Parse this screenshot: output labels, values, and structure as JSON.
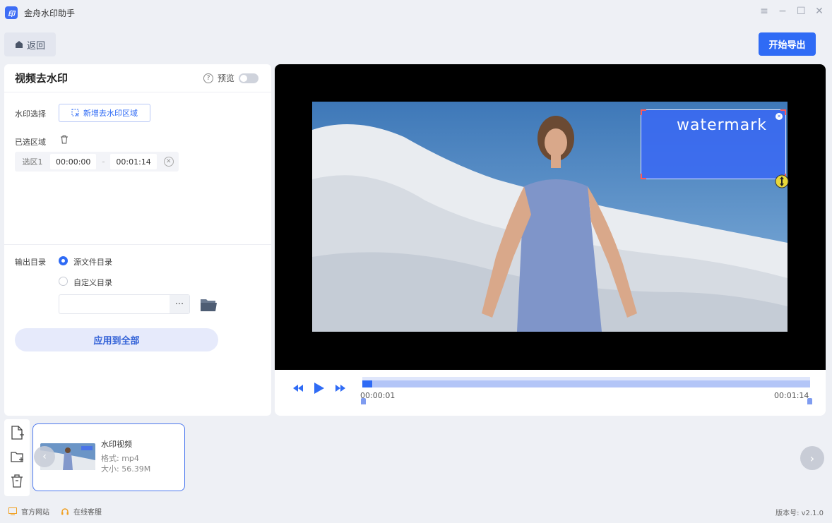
{
  "app": {
    "logo_text": "印",
    "title": "金舟水印助手"
  },
  "window_controls": [
    "menu-icon",
    "minimize-icon",
    "maximize-icon",
    "close-icon"
  ],
  "toolbar": {
    "back_label": "返回",
    "export_label": "开始导出"
  },
  "panel": {
    "title": "视频去水印",
    "preview_label": "预览",
    "preview_on": false,
    "watermark_select_label": "水印选择",
    "add_region_label": "新增去水印区域",
    "selected_regions_label": "已选区域",
    "regions": [
      {
        "name": "选区1",
        "start": "00:00:00",
        "separator": "-",
        "end": "00:01:14"
      }
    ],
    "output_dir_label": "输出目录",
    "output_options": [
      {
        "label": "源文件目录",
        "selected": true
      },
      {
        "label": "自定义目录",
        "selected": false
      }
    ],
    "path_value": "",
    "browse_label": "···",
    "apply_label": "应用到全部"
  },
  "video": {
    "watermark_text": "watermark",
    "time_current": "00:00:01",
    "time_total": "00:01:14",
    "progress": 0.02
  },
  "files": [
    {
      "name": "水印视频",
      "format": "格式: mp4",
      "size": "大小: 56.39M"
    }
  ],
  "footer": {
    "website": "官方网站",
    "support": "在线客服",
    "version": "版本号: v2.1.0"
  },
  "colors": {
    "accent": "#2f6bf5",
    "watermark_box": "#3969f5",
    "panel_bg": "#ffffff",
    "app_bg": "#eef0f5"
  }
}
